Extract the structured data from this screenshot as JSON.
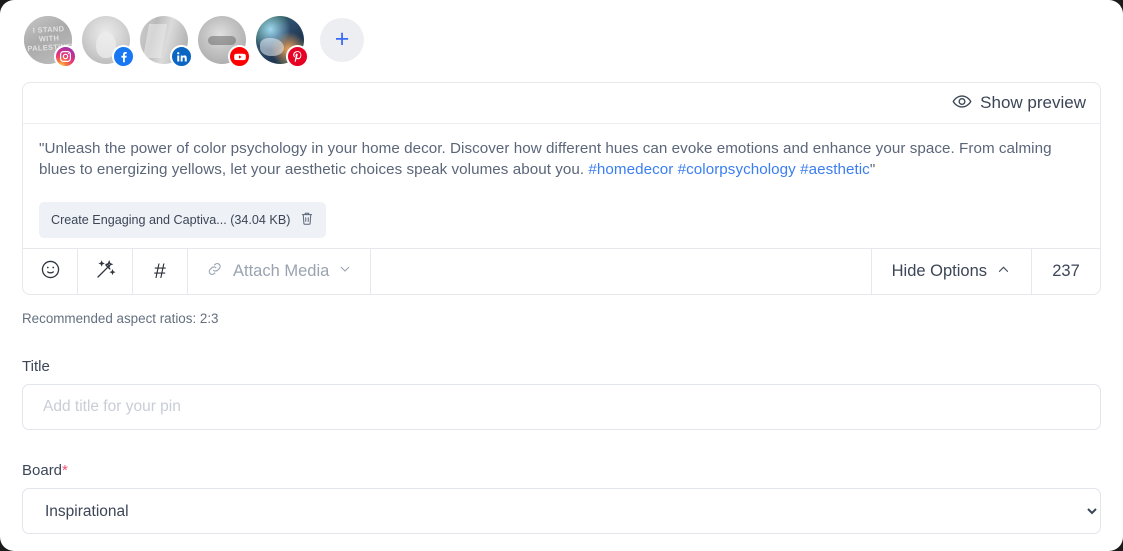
{
  "accounts": {
    "items": [
      {
        "network": "instagram",
        "icon": "instagram-icon",
        "avatar_text": "I STAND WITH PALESTINE",
        "active": false
      },
      {
        "network": "facebook",
        "icon": "facebook-icon",
        "avatar_text": "",
        "active": false
      },
      {
        "network": "linkedin",
        "icon": "linkedin-icon",
        "avatar_text": "",
        "active": false
      },
      {
        "network": "youtube",
        "icon": "youtube-icon",
        "avatar_text": "",
        "active": false
      },
      {
        "network": "pinterest",
        "icon": "pinterest-icon",
        "avatar_text": "",
        "active": true
      }
    ],
    "add_label": "+"
  },
  "composer": {
    "preview_label": "Show preview",
    "preview_icon": "eye-icon",
    "post_text_parts": {
      "before": "\"Unleash the power of color psychology in your home decor. Discover how different hues can evoke emotions and enhance your space. From calming blues to energizing yellows, let your aesthetic choices speak volumes about you. ",
      "tag1": "#homedecor",
      "tag2": "#colorpsychology",
      "tag3": "#aesthetic",
      "after": "\""
    },
    "attachment": {
      "label": "Create Engaging and Captiva... (34.04 KB)",
      "delete_icon": "trash-icon"
    },
    "toolbar": {
      "emoji_icon": "emoji-smiley-icon",
      "ai_icon": "magic-wand-icon",
      "hashtag_icon": "#",
      "attach_label": "Attach Media",
      "attach_icon": "link-icon",
      "attach_chevron": "chevron-down-icon",
      "hide_options_label": "Hide Options",
      "hide_options_chevron": "chevron-up-icon",
      "character_count": "237"
    }
  },
  "options": {
    "aspect_hint": "Recommended aspect ratios: 2:3",
    "title": {
      "label": "Title",
      "placeholder": "Add title for your pin",
      "value": ""
    },
    "board": {
      "label": "Board",
      "required_marker": "*",
      "selected": "Inspirational",
      "options": [
        "Inspirational"
      ]
    }
  },
  "colors": {
    "accent_blue": "#3b7ef0",
    "required_red": "#f4516c",
    "instagram": "#e8367a",
    "facebook": "#1877f2",
    "linkedin": "#0a66c2",
    "youtube": "#ff0000",
    "pinterest": "#e60023"
  }
}
